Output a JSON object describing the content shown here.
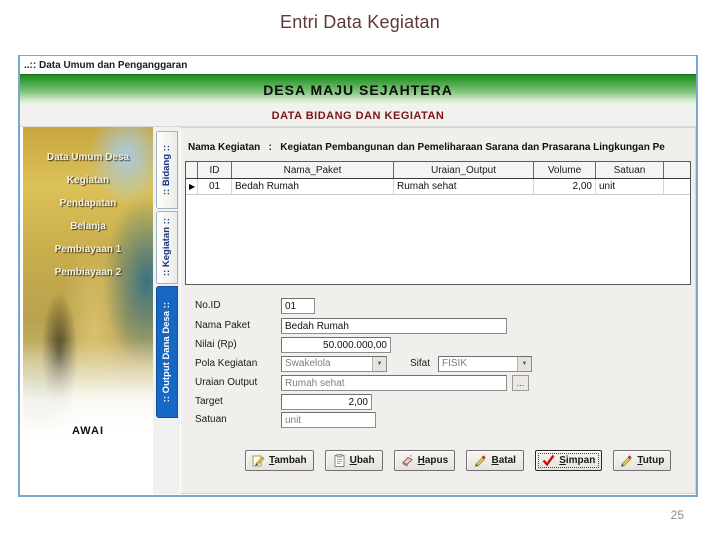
{
  "page": {
    "title": "Entri Data Kegiatan",
    "page_number": "25"
  },
  "window": {
    "titlebar": "..:: Data Umum dan Penganggaran",
    "banner": "DESA MAJU SEJAHTERA",
    "subheader": "DATA BIDANG DAN KEGIATAN"
  },
  "sidebar": {
    "items": [
      {
        "label": "Data Umum Desa"
      },
      {
        "label": "Kegiatan"
      },
      {
        "label": "Pendapatan"
      },
      {
        "label": "Belanja"
      },
      {
        "label": "Pembiayaan 1"
      },
      {
        "label": "Pembiayaan 2"
      }
    ],
    "home_label": "AWAI"
  },
  "tabs": [
    {
      "label": ":: Bidang ::",
      "active": false
    },
    {
      "label": ":: Kegiatan ::",
      "active": false
    },
    {
      "label": ":: Output Dana Desa ::",
      "active": true
    }
  ],
  "main": {
    "activity": {
      "label": "Nama Kegiatan",
      "separator": ":",
      "value": "Kegiatan Pembangunan dan Pemeliharaan Sarana dan Prasarana Lingkungan Pe"
    },
    "grid": {
      "columns": [
        "ID",
        "Nama_Paket",
        "Uraian_Output",
        "Volume",
        "Satuan"
      ],
      "rows": [
        [
          "01",
          "Bedah Rumah",
          "Rumah sehat",
          "2,00",
          "unit"
        ]
      ],
      "selected_row_marker": "▶"
    },
    "form": {
      "no_id": {
        "label": "No.ID",
        "value": "01"
      },
      "nama_paket": {
        "label": "Nama Paket",
        "value": "Bedah Rumah"
      },
      "nilai": {
        "label": "Nilai (Rp)",
        "value": "50.000.000,00"
      },
      "pola_kegiatan": {
        "label": "Pola Kegiatan",
        "value": "Swakelola"
      },
      "sifat": {
        "label": "Sifat",
        "value": "FISIK"
      },
      "uraian_output": {
        "label": "Uraian Output",
        "value": "Rumah sehat",
        "browse_label": "..."
      },
      "target": {
        "label": "Target",
        "value": "2,00"
      },
      "satuan": {
        "label": "Satuan",
        "value": "unit"
      }
    },
    "buttons": [
      {
        "label": "Tambah",
        "icon": "add-icon"
      },
      {
        "label": "Ubah",
        "icon": "edit-icon"
      },
      {
        "label": "Hapus",
        "icon": "delete-icon"
      },
      {
        "label": "Batal",
        "icon": "cancel-icon"
      },
      {
        "label": "Simpan",
        "icon": "save-icon"
      },
      {
        "label": "Tutup",
        "icon": "close-icon"
      }
    ]
  },
  "colors": {
    "banner_green": "#2f9a2f",
    "header_red": "#7c1616",
    "tab_active_blue": "#1668c4",
    "window_border_blue": "#7aa7cc",
    "save_check_red": "#cc1111"
  }
}
